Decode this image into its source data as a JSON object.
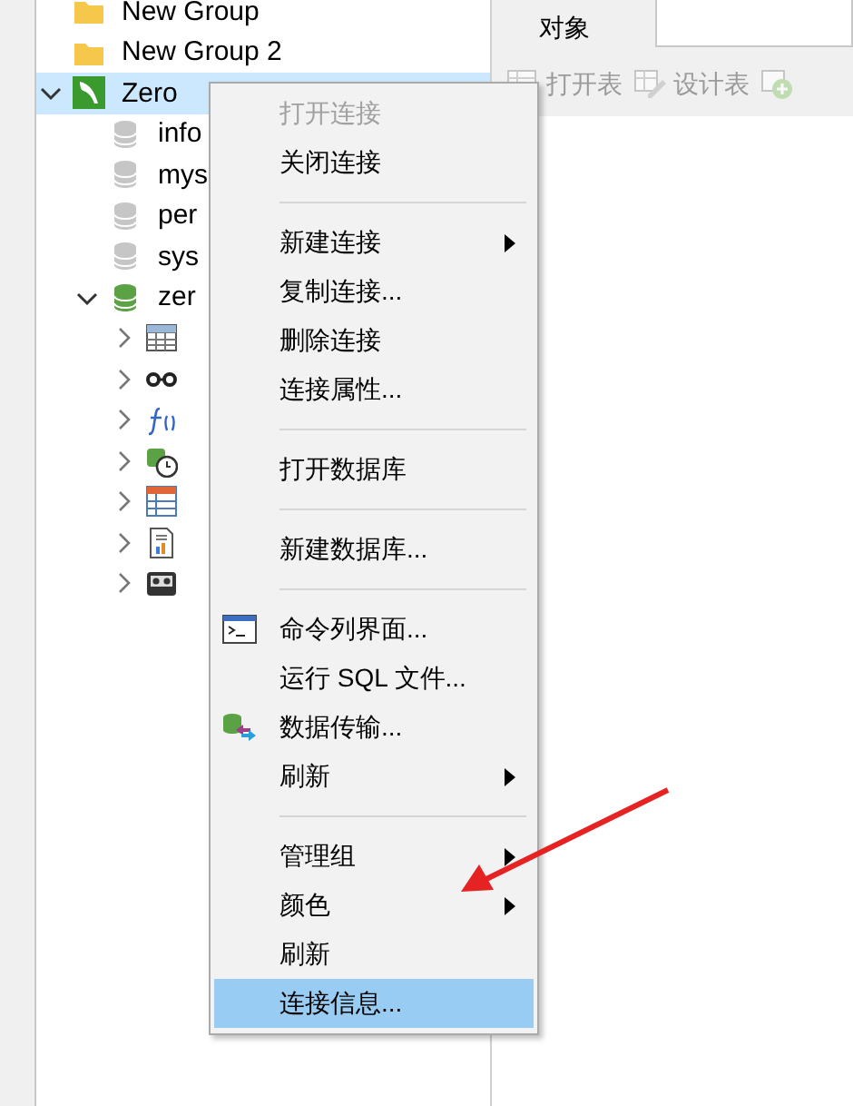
{
  "tree": [
    {
      "label": "New Group",
      "kind": "group"
    },
    {
      "label": "New Group 2",
      "kind": "group"
    },
    {
      "label": "Zero",
      "kind": "connection",
      "expanded": true,
      "selected": true,
      "children": [
        {
          "label": "info",
          "kind": "database",
          "open": false
        },
        {
          "label": "mys",
          "kind": "database",
          "open": false
        },
        {
          "label": "per",
          "kind": "database",
          "open": false
        },
        {
          "label": "sys",
          "kind": "database",
          "open": false
        },
        {
          "label": "zer",
          "kind": "database",
          "open": true,
          "expanded": true,
          "children": [
            {
              "kind": "tables",
              "expanded": false
            },
            {
              "kind": "views",
              "expanded": false
            },
            {
              "kind": "functions",
              "expanded": false
            },
            {
              "kind": "events",
              "expanded": false
            },
            {
              "kind": "queries",
              "expanded": false
            },
            {
              "kind": "reports",
              "expanded": false
            },
            {
              "kind": "backups",
              "expanded": false
            }
          ]
        }
      ]
    }
  ],
  "tabs": [
    {
      "label": "对象",
      "selected": true
    }
  ],
  "toolbar": [
    {
      "kind": "open-table",
      "label": "打开表",
      "disabled": true
    },
    {
      "kind": "design-table",
      "label": "设计表",
      "disabled": true
    },
    {
      "kind": "new-table",
      "disabled": true
    }
  ],
  "context_menu": [
    {
      "kind": "item",
      "label": "打开连接",
      "disabled": true,
      "selected": false
    },
    {
      "kind": "item",
      "label": "关闭连接",
      "disabled": false,
      "selected": false
    },
    {
      "kind": "separator"
    },
    {
      "kind": "item",
      "label": "新建连接",
      "disabled": false,
      "submenu": true,
      "selected": false
    },
    {
      "kind": "item",
      "label": "复制连接...",
      "disabled": false,
      "selected": false
    },
    {
      "kind": "item",
      "label": "删除连接",
      "disabled": false,
      "selected": false
    },
    {
      "kind": "item",
      "label": "连接属性...",
      "disabled": false,
      "selected": false
    },
    {
      "kind": "separator"
    },
    {
      "kind": "item",
      "label": "打开数据库",
      "disabled": false,
      "selected": false
    },
    {
      "kind": "separator"
    },
    {
      "kind": "item",
      "label": "新建数据库...",
      "disabled": false,
      "selected": false
    },
    {
      "kind": "separator"
    },
    {
      "kind": "console",
      "label": "命令列界面...",
      "disabled": false,
      "selected": false
    },
    {
      "kind": "item",
      "label": "运行 SQL 文件...",
      "disabled": false,
      "selected": false
    },
    {
      "kind": "transfer",
      "label": "数据传输...",
      "disabled": false,
      "selected": false
    },
    {
      "kind": "item",
      "label": "刷新",
      "disabled": false,
      "submenu": true,
      "selected": false
    },
    {
      "kind": "separator"
    },
    {
      "kind": "item",
      "label": "管理组",
      "disabled": false,
      "submenu": true,
      "selected": false
    },
    {
      "kind": "item",
      "label": "颜色",
      "disabled": false,
      "submenu": true,
      "selected": false
    },
    {
      "kind": "item",
      "label": "刷新",
      "disabled": false,
      "selected": false
    },
    {
      "kind": "item",
      "label": "连接信息...",
      "disabled": false,
      "selected": true
    }
  ],
  "annotation": {
    "kind": "arrow",
    "color": "#e52323"
  }
}
